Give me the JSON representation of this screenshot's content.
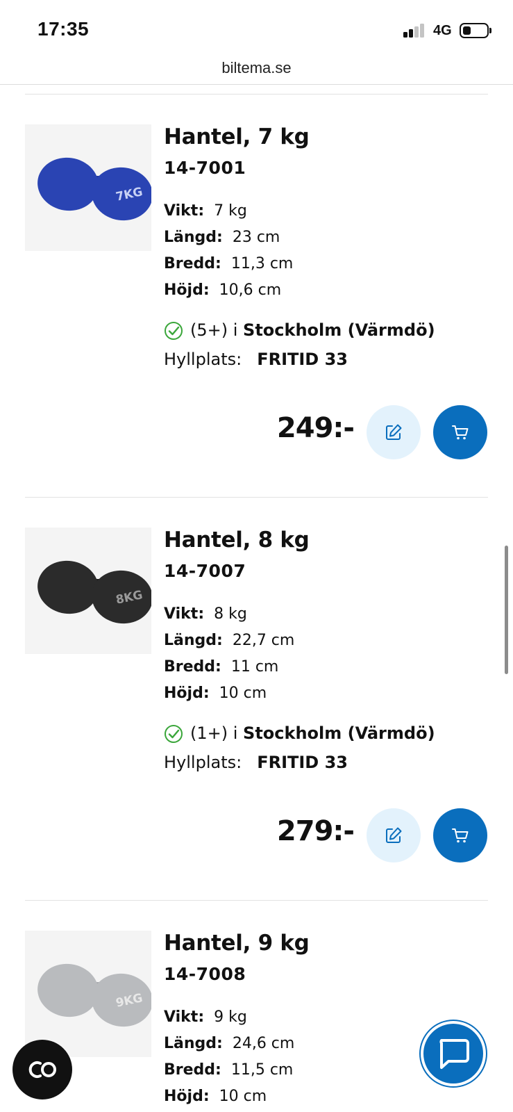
{
  "status_bar": {
    "time": "17:35",
    "network": "4G"
  },
  "browser": {
    "url": "biltema.se"
  },
  "products": [
    {
      "name": "Hantel, 7 kg",
      "sku": "14-7001",
      "image_label": "7KG",
      "image_color": "#2a44b3",
      "specs": [
        {
          "key": "Vikt:",
          "value": "7 kg"
        },
        {
          "key": "Längd:",
          "value": "23 cm"
        },
        {
          "key": "Bredd:",
          "value": "11,3 cm"
        },
        {
          "key": "Höjd:",
          "value": "10,6 cm"
        }
      ],
      "stock_count": "(5+) i ",
      "stock_store": "Stockholm (Värmdö)",
      "shelf_label": "Hyllplats:",
      "shelf_value": "FRITID 33",
      "price": "249:-"
    },
    {
      "name": "Hantel, 8 kg",
      "sku": "14-7007",
      "image_label": "8KG",
      "image_color": "#2b2b2b",
      "specs": [
        {
          "key": "Vikt:",
          "value": "8 kg"
        },
        {
          "key": "Längd:",
          "value": "22,7 cm"
        },
        {
          "key": "Bredd:",
          "value": "11 cm"
        },
        {
          "key": "Höjd:",
          "value": "10 cm"
        }
      ],
      "stock_count": "(1+) i ",
      "stock_store": "Stockholm (Värmdö)",
      "shelf_label": "Hyllplats:",
      "shelf_value": "FRITID 33",
      "price": "279:-"
    },
    {
      "name": "Hantel, 9 kg",
      "sku": "14-7008",
      "image_label": "9KG",
      "image_color": "#b9bbbe",
      "specs": [
        {
          "key": "Vikt:",
          "value": "9 kg"
        },
        {
          "key": "Längd:",
          "value": "24,6 cm"
        },
        {
          "key": "Bredd:",
          "value": "11,5 cm"
        },
        {
          "key": "Höjd:",
          "value": "10 cm"
        }
      ]
    }
  ],
  "colors": {
    "accent": "#0a6ebd",
    "accent_light": "#e3f2fc",
    "stock_ok": "#3aa63a"
  },
  "icons": {
    "edit": "edit-note-icon",
    "cart": "cart-icon",
    "chat": "chat-bubble-icon",
    "co": "co-logo"
  }
}
